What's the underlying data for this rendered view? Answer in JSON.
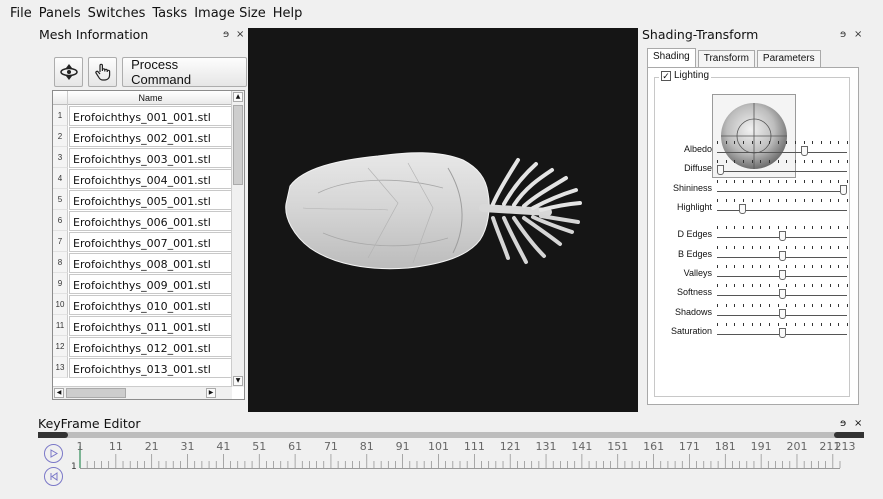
{
  "menu": [
    "File",
    "Panels",
    "Switches",
    "Tasks",
    "Image Size",
    "Help"
  ],
  "mesh_panel": {
    "title": "Mesh Information",
    "float_icon": "ɘ",
    "close_icon": "×",
    "process_button": "Process Command",
    "column_header": "Name",
    "rows": [
      {
        "num": "1",
        "name": "Erofoichthys_001_001.stl"
      },
      {
        "num": "2",
        "name": "Erofoichthys_002_001.stl"
      },
      {
        "num": "3",
        "name": "Erofoichthys_003_001.stl"
      },
      {
        "num": "4",
        "name": "Erofoichthys_004_001.stl"
      },
      {
        "num": "5",
        "name": "Erofoichthys_005_001.stl"
      },
      {
        "num": "6",
        "name": "Erofoichthys_006_001.stl"
      },
      {
        "num": "7",
        "name": "Erofoichthys_007_001.stl"
      },
      {
        "num": "8",
        "name": "Erofoichthys_008_001.stl"
      },
      {
        "num": "9",
        "name": "Erofoichthys_009_001.stl"
      },
      {
        "num": "10",
        "name": "Erofoichthys_010_001.stl"
      },
      {
        "num": "11",
        "name": "Erofoichthys_011_001.stl"
      },
      {
        "num": "12",
        "name": "Erofoichthys_012_001.stl"
      },
      {
        "num": "13",
        "name": "Erofoichthys_013_001.stl"
      }
    ]
  },
  "shading_panel": {
    "title": "Shading-Transform",
    "float_icon": "ɘ",
    "close_icon": "×",
    "tabs": [
      "Shading",
      "Transform",
      "Parameters"
    ],
    "lighting_label": "Lighting",
    "lighting_checked": "☑",
    "sliders": [
      {
        "label": "Albedo",
        "level": 0.68
      },
      {
        "label": "Diffuse",
        "level": 0.0
      },
      {
        "label": "Shininess",
        "level": 1.0
      },
      {
        "label": "Highlight",
        "level": 0.18
      },
      {
        "label": "D Edges",
        "level": 0.5
      },
      {
        "label": "B Edges",
        "level": 0.5
      },
      {
        "label": "Valleys",
        "level": 0.5
      },
      {
        "label": "Softness",
        "level": 0.5
      },
      {
        "label": "Shadows",
        "level": 0.5
      },
      {
        "label": "Saturation",
        "level": 0.5
      }
    ]
  },
  "keyframe": {
    "title": "KeyFrame Editor",
    "float_icon": "ɘ",
    "close_icon": "×",
    "ruler_labels": [
      "1",
      "11",
      "21",
      "31",
      "41",
      "51",
      "61",
      "71",
      "81",
      "91",
      "101",
      "111",
      "121",
      "131",
      "141",
      "151",
      "161",
      "171",
      "181",
      "191",
      "201",
      "211",
      "213"
    ],
    "current_frame": "1",
    "play_icon": "play-icon",
    "reset_icon": "reset-icon"
  }
}
